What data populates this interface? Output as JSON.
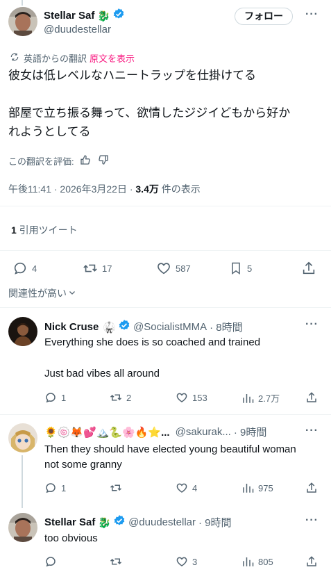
{
  "main_tweet": {
    "author_name": "Stellar Saf",
    "author_handle": "@duudestellar",
    "emoji": "🐉",
    "follow_label": "フォロー",
    "translated_from": "英語からの翻訳",
    "show_original": "原文を表示",
    "text_line1": "彼女は低レベルなハニートラップを仕掛けてる",
    "text_line2": "部屋で立ち振る舞って、欲情したジジイどもから好か",
    "text_line3": "れようとしてる",
    "rate_translation": "この翻訳を評価:",
    "time_date": "午後11:41 · 2026年3月22日 · ",
    "views_count": "3.4万",
    "views_label": " 件の表示",
    "quote_count": "1",
    "quote_label": " 引用ツイート",
    "replies": "4",
    "retweets": "17",
    "likes": "587",
    "bookmarks": "5"
  },
  "sort_label": "関連性が高い",
  "replies": [
    {
      "name": "Nick Cruse",
      "emoji": "🥋",
      "handle": "@SocialistMMA",
      "time": "· 8時間",
      "text_line1": "Everything she does is so coached and trained",
      "text_line2": "Just bad vibes all around",
      "replies": "1",
      "retweets": "2",
      "likes": "153",
      "views": "2.7万"
    },
    {
      "name": "🌻🍥🦊💕🏔️🐍🌸🔥⭐...",
      "handle": "@sakurak...",
      "time": "· 9時間",
      "text_line1": "Then they should have elected young beautiful woman",
      "text_line2": "not some granny",
      "replies": "1",
      "retweets": "",
      "likes": "4",
      "views": "975"
    },
    {
      "name": "Stellar Saf",
      "emoji": "🐉",
      "handle": "@duudestellar",
      "time": "· 9時間",
      "text_line1": "too obvious",
      "replies": "",
      "retweets": "",
      "likes": "3",
      "views": "805"
    }
  ],
  "colors": {
    "verified": "#1d9bf0",
    "link_pink": "#f91880",
    "muted": "#536471",
    "divider": "#eff3f4"
  },
  "icons": {
    "translate": "translate-icon",
    "reply": "reply-icon",
    "retweet": "retweet-icon",
    "like": "heart-icon",
    "bookmark": "bookmark-icon",
    "share": "share-icon",
    "views": "views-icon",
    "verified": "verified-badge-icon",
    "thumbs_up": "thumbs-up-icon",
    "thumbs_down": "thumbs-down-icon",
    "chevron": "chevron-down-icon"
  }
}
